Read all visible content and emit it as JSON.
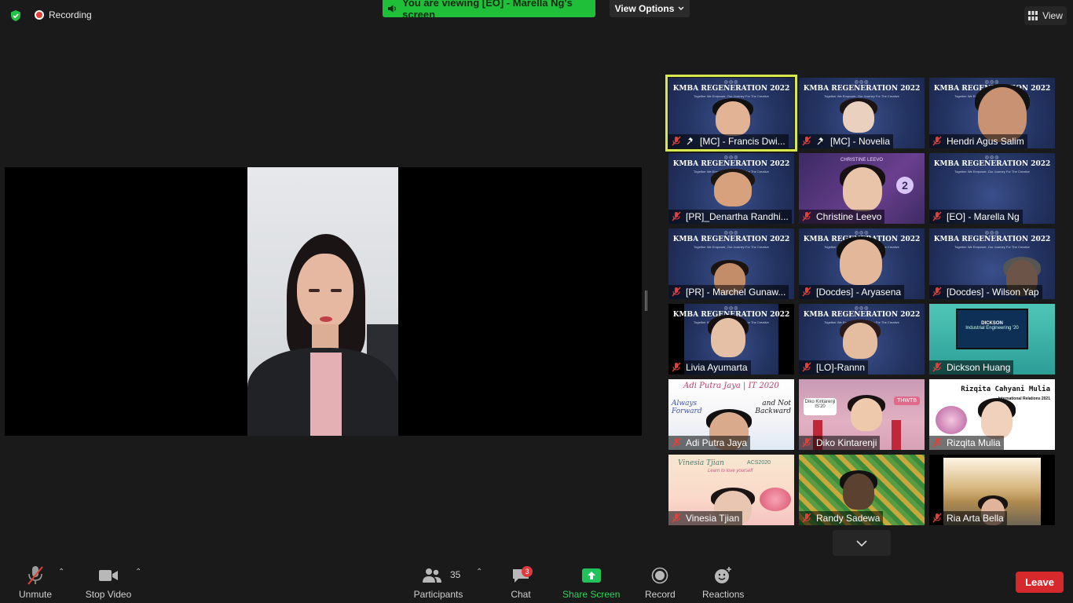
{
  "top": {
    "recording_label": "Recording",
    "viewing_banner": "You are viewing [EO] - Marella Ng's screen",
    "view_options_label": "View Options",
    "view_label": "View"
  },
  "gallery": {
    "kmba_title": "KMBA REGENERATION 2022",
    "kmba_sub": "Together We Empower, Our Journey For The Creative",
    "tiles": [
      {
        "name": "[MC] - Francis Dwi...",
        "pinned": true
      },
      {
        "name": "[MC] - Novelia",
        "pinned": true
      },
      {
        "name": "Hendri Agus Salim"
      },
      {
        "name": "[PR]_Denartha Randhi..."
      },
      {
        "name": "Christine Leevo"
      },
      {
        "name": "[EO] - Marella Ng"
      },
      {
        "name": "[PR] - Marchel Gunaw..."
      },
      {
        "name": "[Docdes] - Aryasena"
      },
      {
        "name": "[Docdes] - Wilson Yap"
      },
      {
        "name": "Livia Ayumarta"
      },
      {
        "name": "[LO]-Rannn"
      },
      {
        "name": "Dickson Huang"
      },
      {
        "name": "Adi Putra Jaya"
      },
      {
        "name": "Diko Kintarenji"
      },
      {
        "name": "Rizqita Mulia"
      },
      {
        "name": "Vinesia Tjian"
      },
      {
        "name": "Randy Sadewa"
      },
      {
        "name": "Ria Arta Bella"
      }
    ],
    "bg_text": {
      "adi_title": "Adi Putra Jaya | IT 2020",
      "adi_left": "Always Forward",
      "adi_right": "and Not Backward",
      "diko_label": "Diko Kintarenji IS'20",
      "diko_tag": "THWTB",
      "rizqita_title": "Rizqita Cahyani Mulia",
      "rizqita_sub": "International Relations 2021",
      "vinesia_title": "Vinesia Tjian",
      "vinesia_tag": "ACS2020",
      "vinesia_sub": "Learn to love yourself",
      "dickson_title": "DICKSON",
      "dickson_sub": "Industrial Engineering '20",
      "christine_title": "CHRISTINE LEEVO",
      "christine_num": "2"
    }
  },
  "toolbar": {
    "unmute": "Unmute",
    "stop_video": "Stop Video",
    "participants": "Participants",
    "participants_count": "35",
    "chat": "Chat",
    "chat_badge": "3",
    "share_screen": "Share Screen",
    "record": "Record",
    "reactions": "Reactions",
    "leave": "Leave"
  },
  "colors": {
    "accent_green": "#1fbf3a",
    "leave_red": "#d6292b",
    "active_speaker": "#d7e84e"
  }
}
